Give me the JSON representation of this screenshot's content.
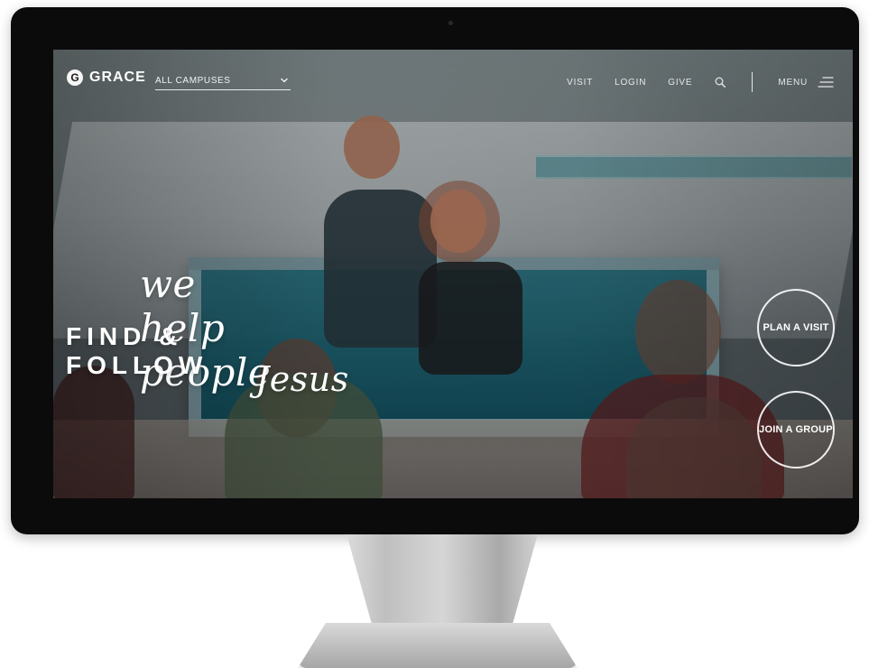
{
  "site": {
    "logo_mark": "G",
    "logo_text": "GRACE",
    "campus_select": {
      "selected": "ALL CAMPUSES",
      "icon": "chevron-down-icon"
    }
  },
  "nav": {
    "links": [
      "VISIT",
      "LOGIN",
      "GIVE"
    ],
    "search_icon": "search-icon",
    "menu_label": "MENU",
    "menu_icon": "hamburger-icon"
  },
  "hero": {
    "line1": "we help people",
    "line2": "FIND & FOLLOW",
    "line3": "Jesus"
  },
  "cta": {
    "plan_visit": "PLAN A VISIT",
    "join_group": "JOIN A GROUP"
  },
  "colors": {
    "bezel": "#0b0b0b",
    "text": "#ffffff"
  },
  "device": {
    "brand_icon": "apple-logo-icon"
  }
}
